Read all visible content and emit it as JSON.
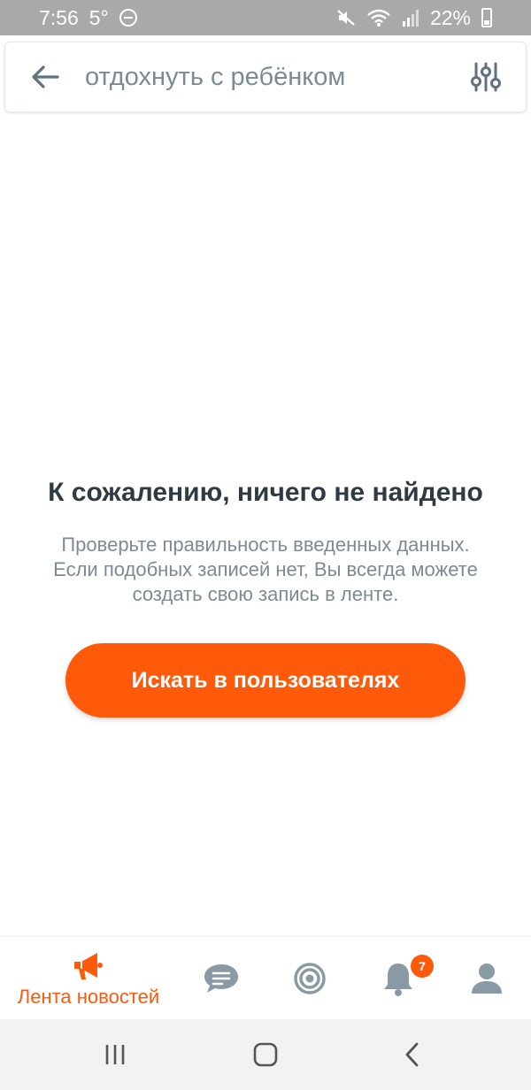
{
  "status_bar": {
    "time": "7:56",
    "temperature": "5°",
    "battery": "22%"
  },
  "search": {
    "query": "отдохнуть с ребёнком",
    "back_icon": "arrow-left-icon",
    "filter_icon": "sliders-icon"
  },
  "empty_state": {
    "title": "К сожалению, ничего не найдено",
    "line1": "Проверьте правильность введенных данных.",
    "line2": "Если подобных записей нет, Вы всегда можете",
    "line3": "создать свою запись в ленте.",
    "button_label": "Искать в пользователях"
  },
  "bottom_nav": {
    "items": [
      {
        "icon": "megaphone-icon",
        "label": "Лента новостей",
        "active": true
      },
      {
        "icon": "chat-icon",
        "label": "",
        "active": false
      },
      {
        "icon": "target-icon",
        "label": "",
        "active": false
      },
      {
        "icon": "bell-icon",
        "label": "",
        "badge": "7",
        "active": false
      },
      {
        "icon": "profile-icon",
        "label": "",
        "active": false
      }
    ]
  },
  "colors": {
    "accent": "#ff5a0a",
    "inactive_icon": "#8a9aa5",
    "title_text": "#2f3b43",
    "secondary_text": "#7d8a93"
  }
}
